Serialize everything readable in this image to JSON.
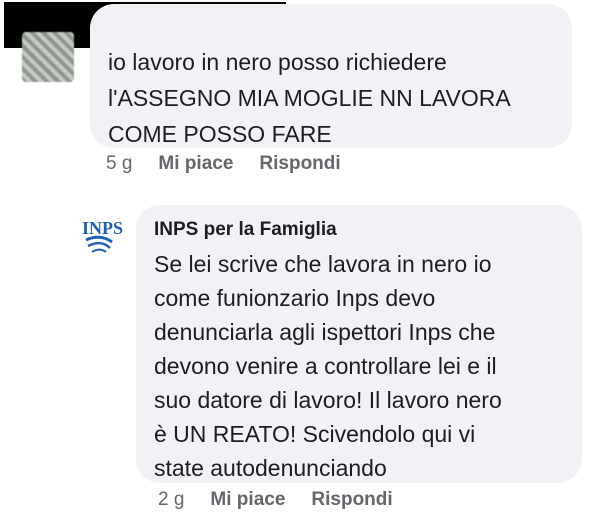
{
  "comment1": {
    "lines": [
      "io lavoro in nero posso richiedere",
      "l'ASSEGNO MIA MOGLIE NN LAVORA",
      "COME POSSO FARE"
    ],
    "time": "5 g",
    "like_label": "Mi piace",
    "reply_label": "Rispondi"
  },
  "comment2": {
    "logo_text": "INPS",
    "author": "INPS per la Famiglia",
    "lines": [
      "Se lei scrive che lavora in nero io",
      "come funionzario Inps devo",
      "denunciarla agli ispettori Inps che",
      "devono venire a controllare lei e il",
      "suo datore di lavoro! Il lavoro nero",
      "è UN REATO! Scivendolo qui vi",
      "state autodenunciando"
    ],
    "time": "2 g",
    "like_label": "Mi piace",
    "reply_label": "Rispondi"
  },
  "colors": {
    "bubble": "#f0f2f5",
    "meta_text": "#65676b",
    "inps_blue": "#1f5fb4"
  }
}
